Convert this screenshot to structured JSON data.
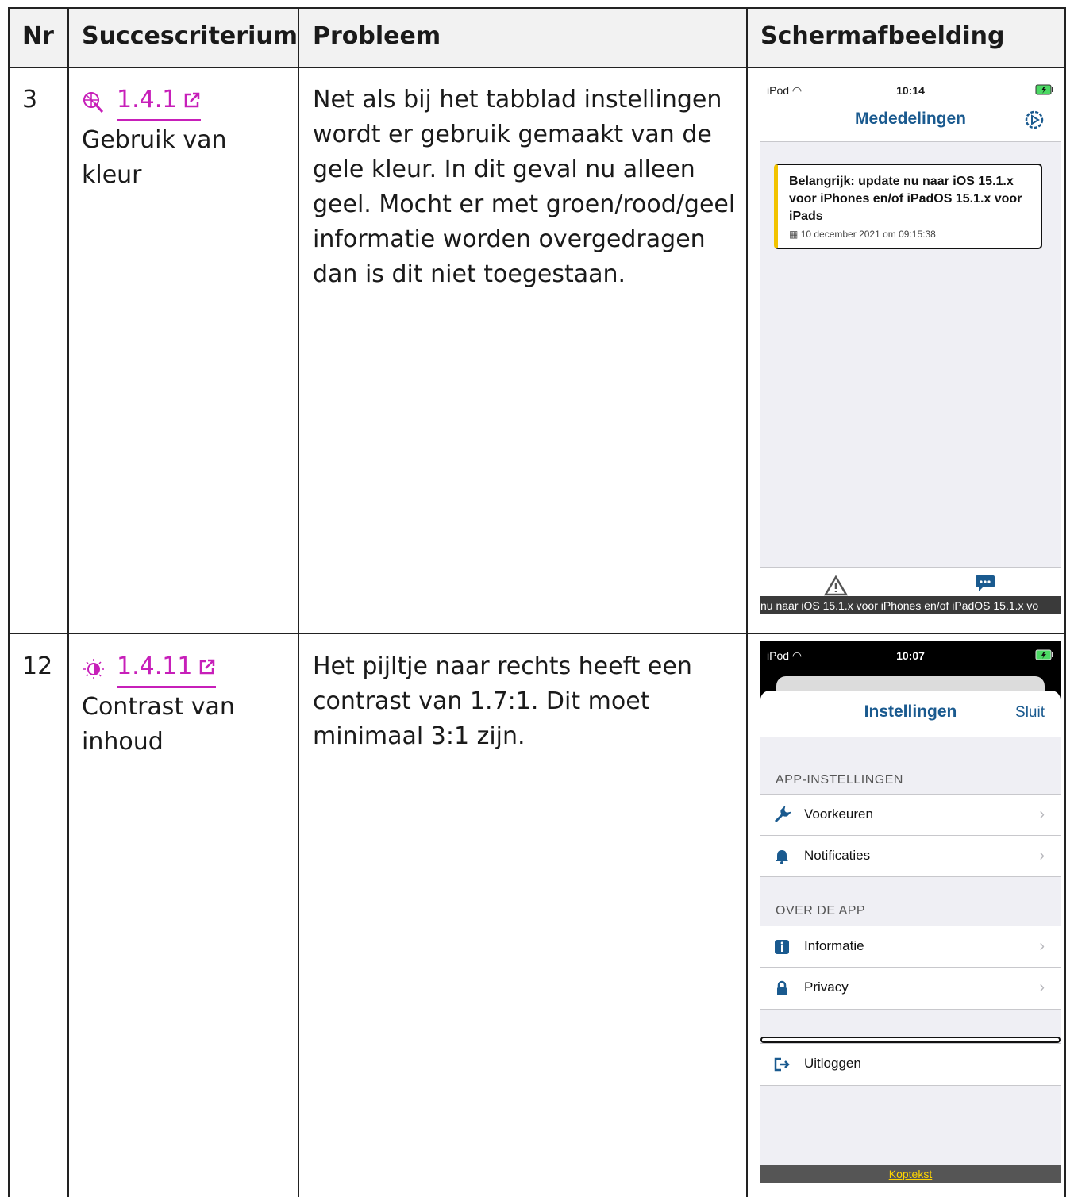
{
  "table": {
    "headers": [
      "Nr",
      "Succescriterium",
      "Probleem",
      "Schermafbeelding"
    ],
    "rows": [
      {
        "nr": "3",
        "criterion_code": "1.4.1",
        "criterion_name": "Gebruik van kleur",
        "problem": "Net als bij het tabblad instellingen wordt er gebruik gemaakt van de gele kleur. In dit geval nu alleen geel. Mocht er met groen/rood/geel informatie worden overgedragen dan is dit niet toegestaan.",
        "icon": "palette-icon"
      },
      {
        "nr": "12",
        "criterion_code": "1.4.11",
        "criterion_name": "Contrast van inhoud",
        "problem": "Het pijltje naar rechts heeft een contrast van 1.7:1. Dit moet minimaal 3:1 zijn.",
        "icon": "contrast-icon"
      }
    ]
  },
  "screen1": {
    "carrier": "iPod",
    "time": "10:14",
    "title": "Mededelingen",
    "card_title": "Belangrijk: update nu naar iOS 15.1.x voor iPhones en/of iPadOS 15.1.x voor iPads",
    "card_date": "10 december 2021 om 09:15:38",
    "ticker": "nu naar iOS 15.1.x voor iPhones en/of iPadOS 15.1.x vo",
    "accent": "#f2c300"
  },
  "screen2": {
    "carrier": "iPod",
    "time": "10:07",
    "title": "Instellingen",
    "close": "Sluit",
    "section1": "APP-INSTELLINGEN",
    "item_voorkeuren": "Voorkeuren",
    "item_notificaties": "Notificaties",
    "section2": "OVER DE APP",
    "item_informatie": "Informatie",
    "item_privacy": "Privacy",
    "item_uitloggen": "Uitloggen",
    "footer": "Koptekst"
  },
  "colors": {
    "link": "#c71fb9",
    "app_blue": "#1a5a8f"
  }
}
